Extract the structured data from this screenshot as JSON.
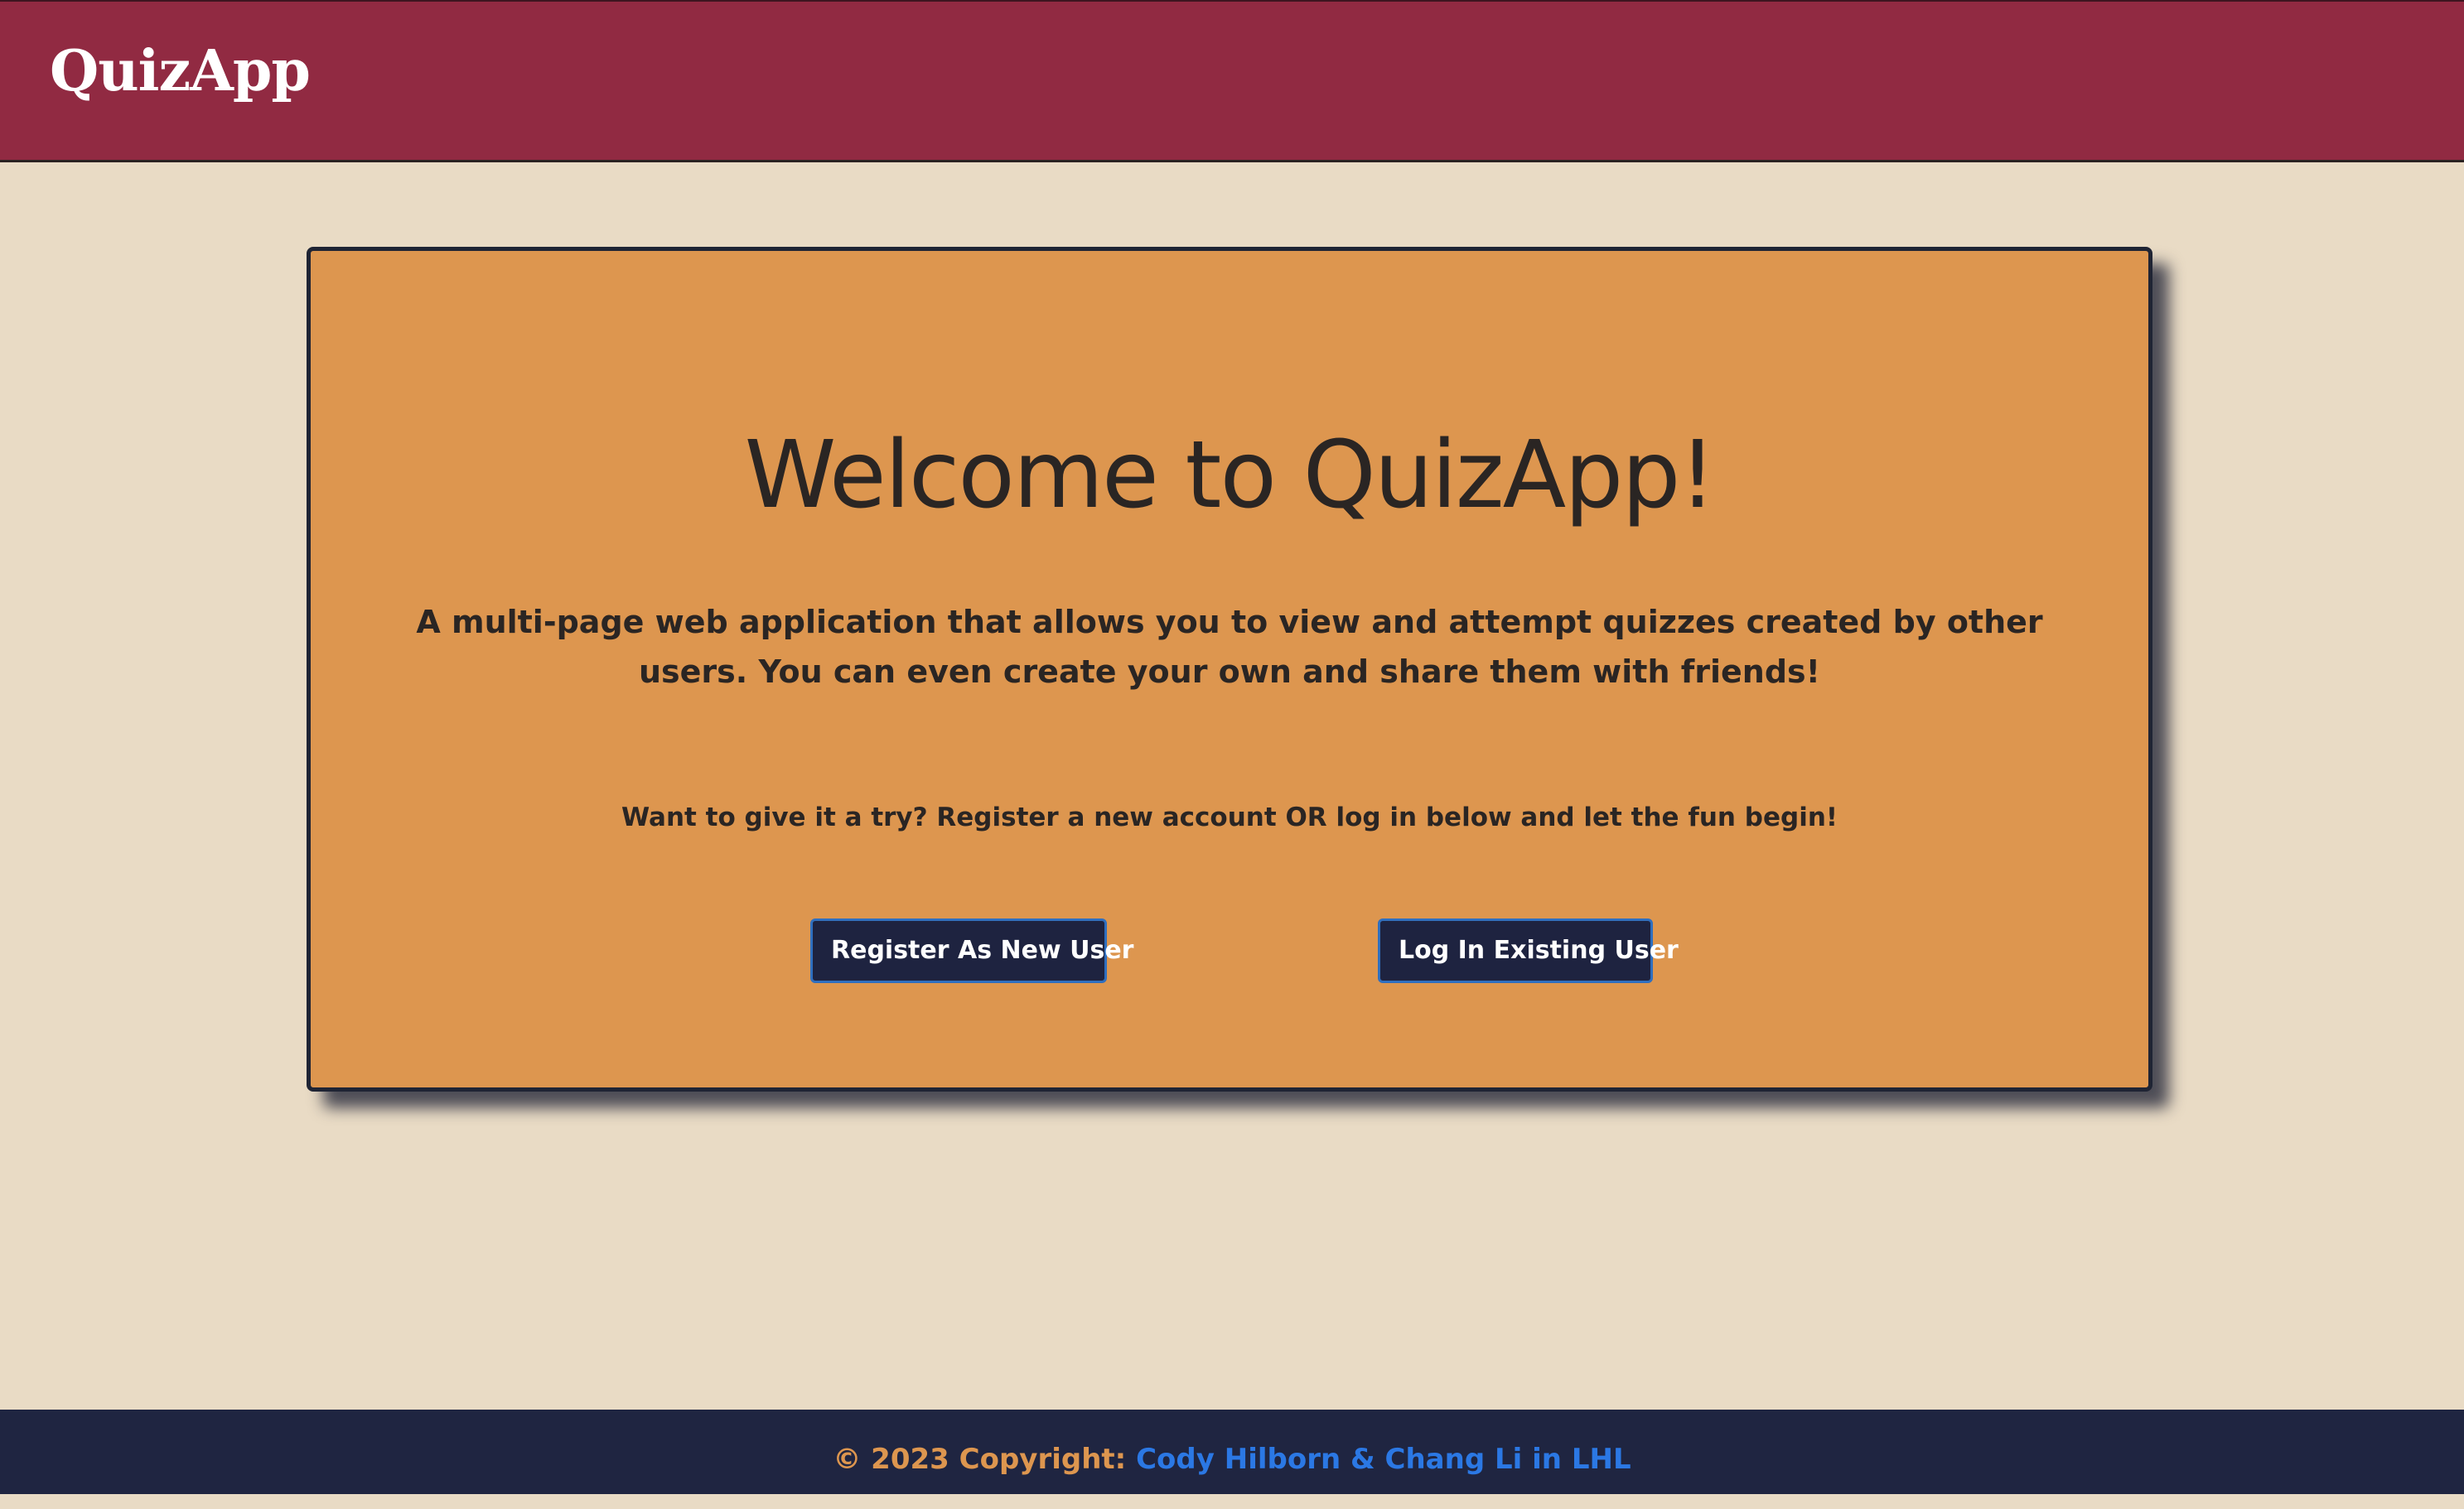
{
  "navbar": {
    "brand": "QuizApp"
  },
  "colors": {
    "navbar_bg": "#912a42",
    "page_bg": "#e9dbc5",
    "card_bg": "#dd964f",
    "button_bg": "#1e2340",
    "footer_bg": "#1f2541",
    "link": "#2b78e4"
  },
  "hero": {
    "title": "Welcome to QuizApp!",
    "description": "A multi-page web application that allows you to view and attempt quizzes created by other users. You can even create your own and share them with friends!",
    "cta_text": "Want to give it a try? Register a new account OR log in below and let the fun begin!",
    "register_label": "Register As New User",
    "login_label": "Log In Existing User"
  },
  "footer": {
    "copyright": "© 2023 Copyright: ",
    "authors_link": "Cody Hilborn & Chang Li in LHL"
  }
}
